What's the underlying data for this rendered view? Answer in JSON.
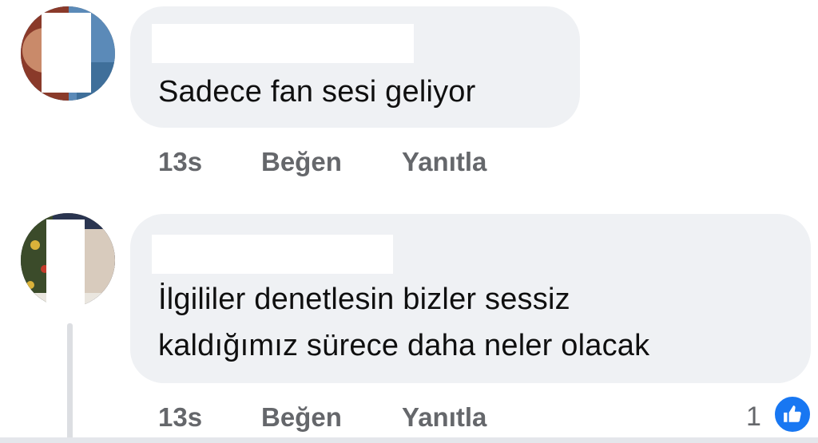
{
  "comments": [
    {
      "text": "Sadece fan sesi geliyor",
      "time": "13s",
      "like_label": "Beğen",
      "reply_label": "Yanıtla"
    },
    {
      "text_line1": "İlgililer denetlesin bizler sessiz",
      "text_line2": "kaldığımız sürece daha neler olacak",
      "time": "13s",
      "like_label": "Beğen",
      "reply_label": "Yanıtla",
      "reaction_count": "1",
      "reaction_icon": "thumbs-up-icon"
    }
  ],
  "colors": {
    "bubble": "#eff1f4",
    "action_text": "#65676b",
    "like_blue": "#1877f2"
  }
}
